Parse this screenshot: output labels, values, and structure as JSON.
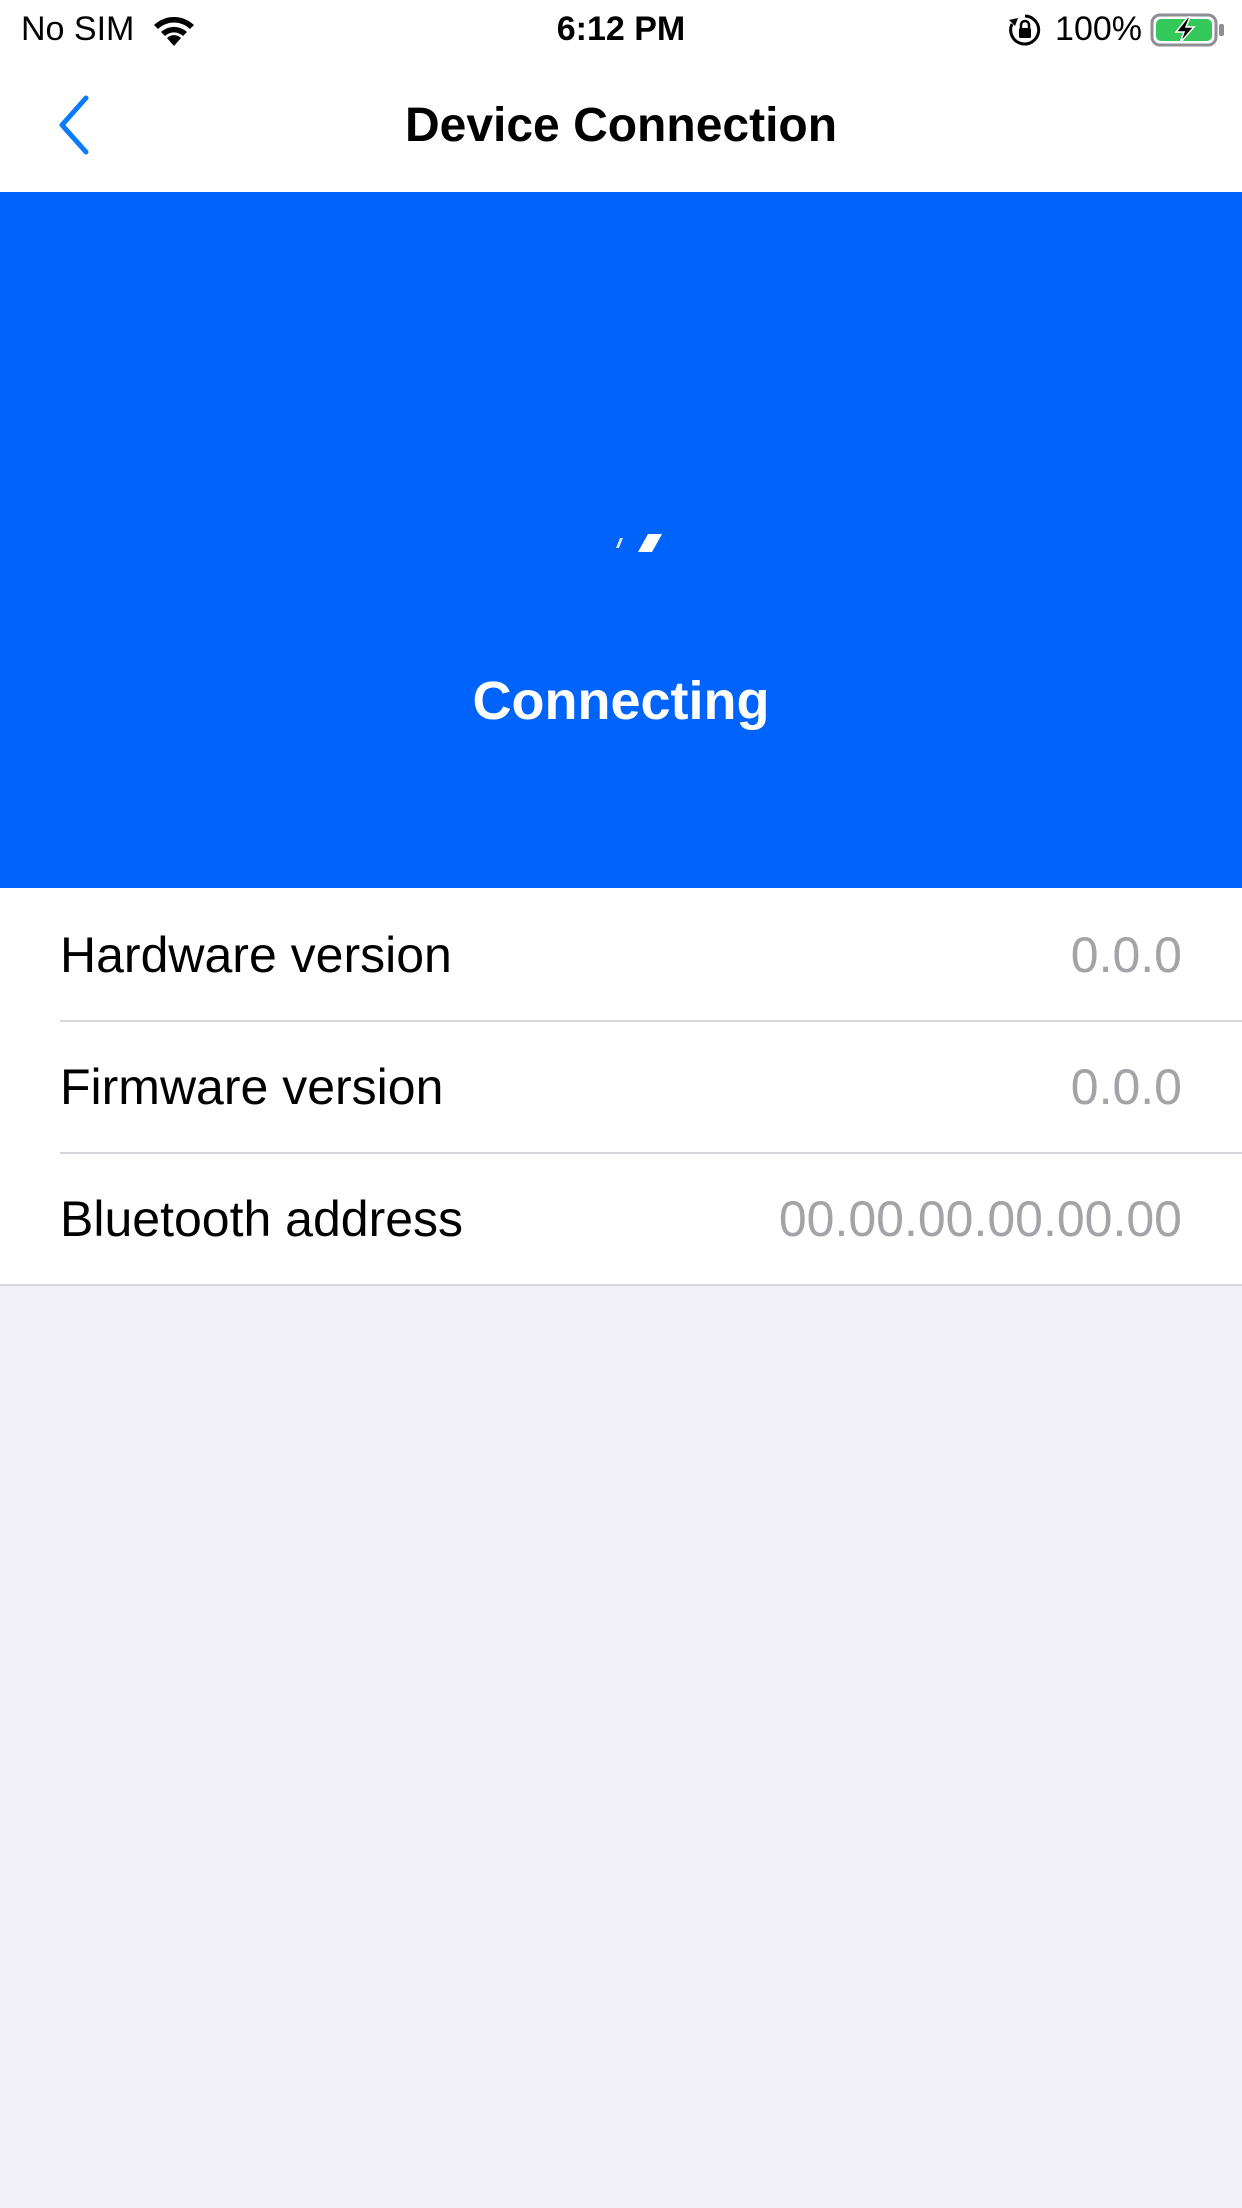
{
  "status_bar": {
    "carrier": "No SIM",
    "time": "6:12 PM",
    "battery_percent": "100%",
    "icons": [
      "wifi-icon",
      "orientation-lock-icon",
      "battery-charging-icon"
    ]
  },
  "nav": {
    "title": "Device Connection",
    "back_icon": "chevron-left-icon"
  },
  "hero": {
    "status_text": "Connecting",
    "spinner_icon": "activity-spinner-icon",
    "background_color": "#0064fa"
  },
  "info": {
    "rows": [
      {
        "label": "Hardware version",
        "value": "0.0.0"
      },
      {
        "label": "Firmware version",
        "value": "0.0.0"
      },
      {
        "label": "Bluetooth address",
        "value": "00.00.00.00.00.00"
      }
    ]
  },
  "colors": {
    "accent": "#0a7aff",
    "hero": "#0064fa",
    "secondary_text": "#a3a3a8",
    "background": "#f0f0f6",
    "battery_green": "#34c759"
  }
}
